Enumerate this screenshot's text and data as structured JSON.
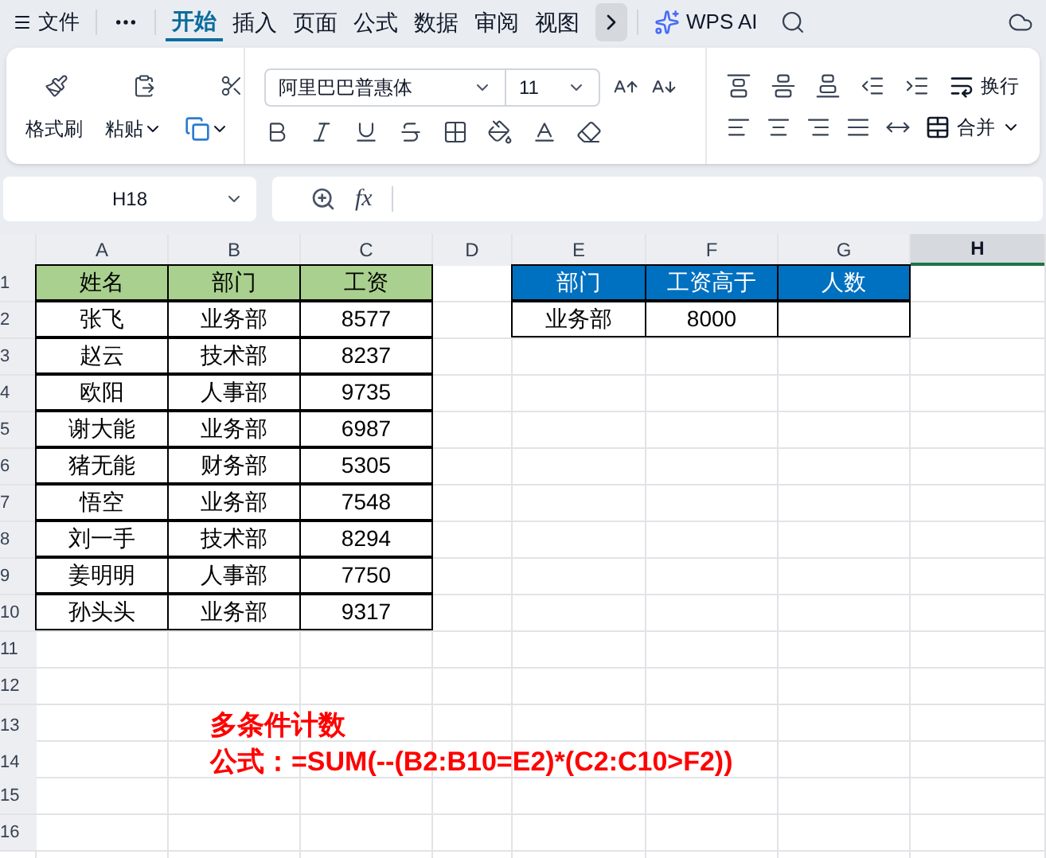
{
  "menu_tabs": [
    {
      "label": "文件",
      "selected": false
    },
    {
      "label": "开始",
      "selected": true
    },
    {
      "label": "插入",
      "selected": false
    },
    {
      "label": "页面",
      "selected": false
    },
    {
      "label": "公式",
      "selected": false
    },
    {
      "label": "数据",
      "selected": false
    },
    {
      "label": "审阅",
      "selected": false
    },
    {
      "label": "视图",
      "selected": false
    }
  ],
  "ai_button": "WPS AI",
  "ribbon": {
    "format_painter": "格式刷",
    "paste": "粘贴",
    "font_name": "阿里巴巴普惠体",
    "font_size": "11",
    "wrap": "换行",
    "merge": "合并"
  },
  "name_box": "H18",
  "function_label": "fx",
  "columns": [
    {
      "label": "A",
      "selected": false
    },
    {
      "label": "B",
      "selected": false
    },
    {
      "label": "C",
      "selected": false
    },
    {
      "label": "D",
      "selected": false
    },
    {
      "label": "E",
      "selected": false
    },
    {
      "label": "F",
      "selected": false
    },
    {
      "label": "G",
      "selected": false
    },
    {
      "label": "H",
      "selected": true
    }
  ],
  "rows": [
    {
      "number": "1",
      "cells": [
        {
          "kind": "header",
          "color": "#a9d08e",
          "text": "姓名"
        },
        {
          "kind": "header",
          "color": "#a9d08e",
          "text": "部门"
        },
        {
          "kind": "header",
          "color": "#a9d08e",
          "text": "工资"
        },
        {
          "kind": "empty"
        },
        {
          "kind": "header",
          "color": "#0070c0",
          "text": "部门"
        },
        {
          "kind": "header",
          "color": "#0070c0",
          "text": "工资高于"
        },
        {
          "kind": "header",
          "color": "#0070c0",
          "text": "人数"
        }
      ]
    },
    {
      "number": "2",
      "cells": [
        {
          "kind": "data",
          "text": "张飞"
        },
        {
          "kind": "data",
          "text": "业务部"
        },
        {
          "kind": "data",
          "text": "8577"
        },
        {
          "kind": "empty"
        },
        {
          "kind": "data",
          "text": "业务部"
        },
        {
          "kind": "data",
          "text": "8000"
        },
        {
          "kind": "data"
        }
      ]
    },
    {
      "number": "3",
      "cells": [
        {
          "kind": "data",
          "text": "赵云"
        },
        {
          "kind": "data",
          "text": "技术部"
        },
        {
          "kind": "data",
          "text": "8237"
        }
      ]
    },
    {
      "number": "4",
      "cells": [
        {
          "kind": "data",
          "text": "欧阳"
        },
        {
          "kind": "data",
          "text": "人事部"
        },
        {
          "kind": "data",
          "text": "9735"
        }
      ]
    },
    {
      "number": "5",
      "cells": [
        {
          "kind": "data",
          "text": "谢大能"
        },
        {
          "kind": "data",
          "text": "业务部"
        },
        {
          "kind": "data",
          "text": "6987"
        }
      ]
    },
    {
      "number": "6",
      "cells": [
        {
          "kind": "data",
          "text": "猪无能"
        },
        {
          "kind": "data",
          "text": "财务部"
        },
        {
          "kind": "data",
          "text": "5305"
        }
      ]
    },
    {
      "number": "7",
      "cells": [
        {
          "kind": "data",
          "text": "悟空"
        },
        {
          "kind": "data",
          "text": "业务部"
        },
        {
          "kind": "data",
          "text": "7548"
        }
      ]
    },
    {
      "number": "8",
      "cells": [
        {
          "kind": "data",
          "text": "刘一手"
        },
        {
          "kind": "data",
          "text": "技术部"
        },
        {
          "kind": "data",
          "text": "8294"
        }
      ]
    },
    {
      "number": "9",
      "cells": [
        {
          "kind": "data",
          "text": "姜明明"
        },
        {
          "kind": "data",
          "text": "人事部"
        },
        {
          "kind": "data",
          "text": "7750"
        }
      ]
    },
    {
      "number": "10",
      "cells": [
        {
          "kind": "data",
          "text": "孙头头"
        },
        {
          "kind": "data",
          "text": "业务部"
        },
        {
          "kind": "data",
          "text": "9317"
        }
      ]
    },
    {
      "number": "11"
    },
    {
      "number": "12"
    },
    {
      "number": "13",
      "cells": [
        {
          "kind": "empty"
        },
        {
          "kind": "note",
          "text": "多条件计数"
        }
      ]
    },
    {
      "number": "14",
      "cells": [
        {
          "kind": "empty"
        },
        {
          "kind": "note",
          "text": "公式：=SUM(--(B2:B10=E2)*(C2:C10>F2))"
        }
      ]
    },
    {
      "number": "15"
    },
    {
      "number": "16"
    }
  ]
}
